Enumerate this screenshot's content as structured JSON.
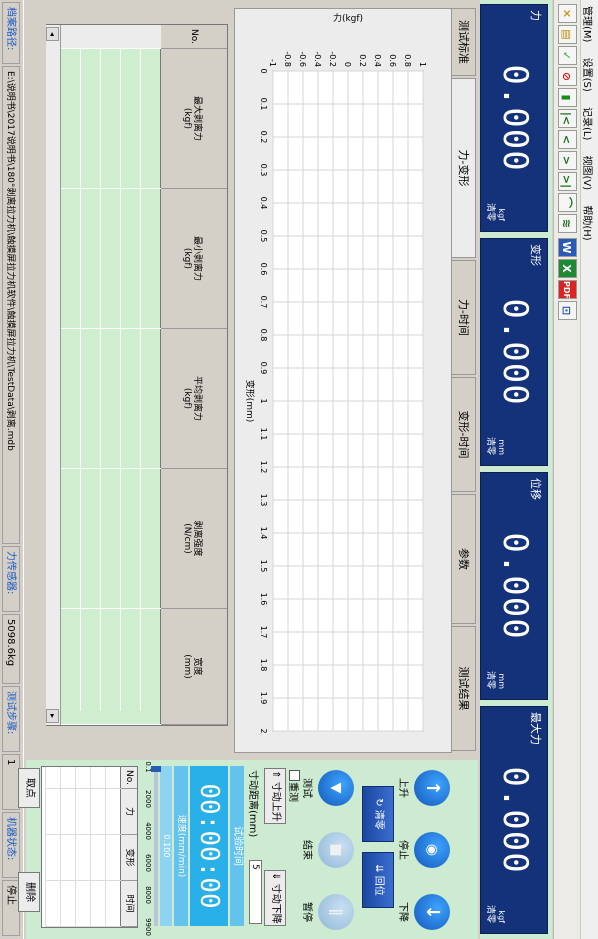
{
  "menu": [
    "管理(M)",
    "设置(S)",
    "记录(L)",
    "视图(V)",
    "帮助(H)"
  ],
  "toolbar_icons": [
    "tools-icon",
    "export-icon",
    "chart-icon",
    "stop-record-icon",
    "clear-icon",
    "first-icon",
    "prev-icon",
    "next-icon",
    "last-icon",
    "curve-icon",
    "multi-curve-icon",
    "word-icon",
    "excel-icon",
    "pdf-icon",
    "network-icon"
  ],
  "displays": [
    {
      "label": "力",
      "value": "0.000",
      "unit": "kgf",
      "zero": "清零"
    },
    {
      "label": "变形",
      "value": "0.000",
      "unit": "mm",
      "zero": "清零"
    },
    {
      "label": "位移",
      "value": "0.000",
      "unit": "mm",
      "zero": "清零"
    },
    {
      "label": "最大力",
      "value": "0.000",
      "unit": "kgf",
      "zero": "清零"
    }
  ],
  "tabs": [
    "测试标准",
    "力-变形",
    "力-时间",
    "变形-时间",
    "参数",
    "测试结果"
  ],
  "chart_data": {
    "type": "line",
    "xlabel": "变形(mm)",
    "ylabel": "力(kgf)",
    "xlim": [
      0,
      2
    ],
    "ylim": [
      -1,
      1
    ],
    "x_ticks": [
      "0",
      "0.1",
      "0.2",
      "0.3",
      "0.4",
      "0.5",
      "0.6",
      "0.7",
      "0.8",
      "0.9",
      "1",
      "1.1",
      "1.2",
      "1.3",
      "1.4",
      "1.5",
      "1.6",
      "1.7",
      "1.8",
      "1.9",
      "2"
    ],
    "y_ticks": [
      "-1",
      "-0.8",
      "-0.6",
      "-0.4",
      "-0.2",
      "0",
      "0.2",
      "0.4",
      "0.6",
      "0.8",
      "1"
    ],
    "series": [],
    "grid": true
  },
  "results_table": {
    "columns": [
      "No.",
      "最大剥离力\n(kgf)",
      "最小剥离力\n(kgf)",
      "平均剥离力\n(kgf)",
      "剥离强度\n(N/cm)",
      "宽度\n(mm)"
    ],
    "rows": []
  },
  "status": {
    "path_label": "档案路径:",
    "path_value": "E:\\说明书\\2017说明书\\180°剥离拉力机\\触摸屏拉力机软件\\触摸屏拉力机\\TestData\\剥离.mdb",
    "sensor_label": "力传感器:",
    "sensor_value": "5098.6kg",
    "steps_label": "测试步骤:",
    "steps_value": "1",
    "state_label": "机器状态:",
    "state_value": "停止"
  },
  "controls": {
    "up": "上升",
    "stop": "停止",
    "down": "下降",
    "zero_all": "清零",
    "return": "回位",
    "test": "测试",
    "end": "结束",
    "pause": "暂停",
    "reset_label": "重测",
    "jog_label": "寸动距离(mm)",
    "jog_value": "5",
    "jog_up": "寸动上升",
    "jog_down": "寸动下降",
    "time_label": "试验时间",
    "time_value": "00:00:00",
    "speed_label": "速度(mm/min)",
    "speed_value": "0.100",
    "speed_ticks": [
      "0.1",
      "2000",
      "4000",
      "6000",
      "8000",
      "9900"
    ],
    "mini_columns": [
      "No.",
      "力",
      "变形",
      "时间"
    ],
    "pick_point": "取点",
    "delete": "删除"
  }
}
